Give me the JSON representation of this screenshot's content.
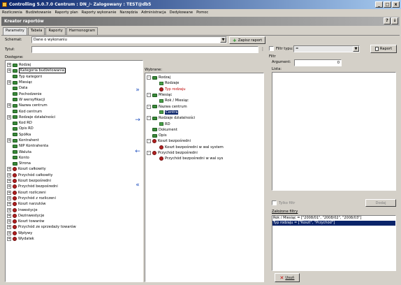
{
  "window": {
    "title": "Controlling 5.0.7.0  Centrum : DN_/-    Zalogowany : TEST@db5",
    "btn_min": "_",
    "btn_max": "□",
    "btn_close": "x"
  },
  "menu": [
    "Rozliczenia",
    "Budżetowanie",
    "Raporty plan",
    "Raporty wykonanie",
    "Narzędzia",
    "Administracja",
    "Dedykowane",
    "Pomoc"
  ],
  "inner": {
    "title": "Kreator raportów",
    "btn_help": "?",
    "btn_pin": "↓"
  },
  "tabs": [
    "Parametry",
    "Tabela",
    "Raporty",
    "Harmonogram"
  ],
  "schemat": {
    "label": "Schemat:",
    "value": "Dane o wykonaniu",
    "save": "Zapisz raport"
  },
  "tytul": {
    "label": "Tytuł:",
    "value": ""
  },
  "dostepne": {
    "label": "Dostępne:",
    "items": [
      {
        "text": "Rodzaj",
        "exp": "+",
        "icon": "dim",
        "style": ""
      },
      {
        "text": "Kategoria budżetowania",
        "exp": "+",
        "icon": "dim",
        "style": "boxed"
      },
      {
        "text": "Typ kategorii",
        "exp": "",
        "icon": "dim",
        "style": ""
      },
      {
        "text": "Miesiąc",
        "exp": "+",
        "icon": "dim",
        "style": ""
      },
      {
        "text": "Data",
        "exp": "",
        "icon": "dim",
        "style": ""
      },
      {
        "text": "Pochodzenie",
        "exp": "",
        "icon": "dim",
        "style": ""
      },
      {
        "text": "W wersyfikacji",
        "exp": "",
        "icon": "dim",
        "style": ""
      },
      {
        "text": "Nazwa centrum",
        "exp": "+",
        "icon": "dim",
        "style": ""
      },
      {
        "text": "Kod centrum",
        "exp": "",
        "icon": "dim",
        "style": ""
      },
      {
        "text": "Rodzaje działalności",
        "exp": "+",
        "icon": "dim",
        "style": ""
      },
      {
        "text": "Kod RD",
        "exp": "",
        "icon": "dim",
        "style": ""
      },
      {
        "text": "Opis RD",
        "exp": "",
        "icon": "dim",
        "style": ""
      },
      {
        "text": "Spółka",
        "exp": "",
        "icon": "dim",
        "style": ""
      },
      {
        "text": "Kontrahent",
        "exp": "+",
        "icon": "dim",
        "style": ""
      },
      {
        "text": "NIP Kontrahenta",
        "exp": "",
        "icon": "dim",
        "style": ""
      },
      {
        "text": "Waluta",
        "exp": "",
        "icon": "dim",
        "style": ""
      },
      {
        "text": "Konto",
        "exp": "",
        "icon": "dim",
        "style": ""
      },
      {
        "text": "Strona",
        "exp": "",
        "icon": "dim",
        "style": ""
      },
      {
        "text": "Koszt całkowity",
        "exp": "+",
        "icon": "meas",
        "style": ""
      },
      {
        "text": "Przychód całkowity",
        "exp": "+",
        "icon": "meas",
        "style": ""
      },
      {
        "text": "Koszt bezpośredni",
        "exp": "+",
        "icon": "meas",
        "style": ""
      },
      {
        "text": "Przychód bezpośredni",
        "exp": "+",
        "icon": "meas",
        "style": ""
      },
      {
        "text": "Koszt rozliczeni",
        "exp": "+",
        "icon": "meas",
        "style": ""
      },
      {
        "text": "Przychód z rozliczeni",
        "exp": "+",
        "icon": "meas",
        "style": ""
      },
      {
        "text": "Koszt narzutów",
        "exp": "+",
        "icon": "meas",
        "style": ""
      },
      {
        "text": "Inwestycje",
        "exp": "+",
        "icon": "meas",
        "style": ""
      },
      {
        "text": "Dezinwestycje",
        "exp": "+",
        "icon": "meas",
        "style": ""
      },
      {
        "text": "Koszt towarów",
        "exp": "+",
        "icon": "meas",
        "style": ""
      },
      {
        "text": "Przychód ze sprzedaży towarów",
        "exp": "+",
        "icon": "meas",
        "style": ""
      },
      {
        "text": "Wpływy",
        "exp": "+",
        "icon": "meas",
        "style": ""
      },
      {
        "text": "Wydatek",
        "exp": "+",
        "icon": "meas",
        "style": ""
      }
    ]
  },
  "wybrane": {
    "label": "Wybrane:",
    "items": [
      {
        "text": "Rodzaj",
        "exp": "-",
        "icon": "dim",
        "style": "",
        "indent": 0
      },
      {
        "text": "Rodzaje",
        "exp": "",
        "icon": "sub",
        "style": "",
        "indent": 1
      },
      {
        "text": "Typ rodzaju",
        "exp": "",
        "icon": "meas",
        "style": "red",
        "indent": 1
      },
      {
        "text": "Miesiąc",
        "exp": "-",
        "icon": "dim",
        "style": "",
        "indent": 0
      },
      {
        "text": "Rok / Miesiąc",
        "exp": "",
        "icon": "sub",
        "style": "",
        "indent": 1
      },
      {
        "text": "Nazwa centrum",
        "exp": "-",
        "icon": "dim",
        "style": "",
        "indent": 0
      },
      {
        "text": "Centra",
        "exp": "",
        "icon": "sub",
        "style": "sel",
        "indent": 1
      },
      {
        "text": "Rodzaje działalności",
        "exp": "-",
        "icon": "dim",
        "style": "",
        "indent": 0
      },
      {
        "text": "RD",
        "exp": "",
        "icon": "sub",
        "style": "",
        "indent": 1
      },
      {
        "text": "Dokument",
        "exp": "",
        "icon": "dim",
        "style": "",
        "indent": 0
      },
      {
        "text": "Opis",
        "exp": "",
        "icon": "dim",
        "style": "",
        "indent": 0
      },
      {
        "text": "Koszt bezpośredni",
        "exp": "-",
        "icon": "meas",
        "style": "",
        "indent": 0
      },
      {
        "text": "Koszt bezpośredni w wal system",
        "exp": "",
        "icon": "meas",
        "style": "",
        "indent": 1
      },
      {
        "text": "Przychód bezpośredni",
        "exp": "-",
        "icon": "meas",
        "style": "",
        "indent": 0
      },
      {
        "text": "Przychód bezpośredni w wal sys",
        "exp": "",
        "icon": "meas",
        "style": "",
        "indent": 1
      }
    ]
  },
  "transfer": {
    "add_all": "»",
    "add": "→",
    "remove": "←",
    "remove_all": "«"
  },
  "right": {
    "filtr_typu": "Filtr typu:",
    "filtr_typu_value": "=",
    "raport": "Raport",
    "filtr_group": "Filtr",
    "argument": "Argument:",
    "argument_value": "0",
    "lista": "Lista:",
    "tylko_filtr": "Tylko filtr",
    "dodaj": "Dodaj",
    "zalozone": "Założone filtry",
    "filters": [
      "Rok / Miesiąc = [\"2008/01\", \"2008/02\", \"2008/03\"]",
      "Typ rodzaju = [\"Koszt\", \"Przychód\"]"
    ],
    "usun": "Usuń"
  },
  "colors": {
    "accent": "#0a246a",
    "measure": "#b02020",
    "dimension": "#3a8a3a"
  }
}
